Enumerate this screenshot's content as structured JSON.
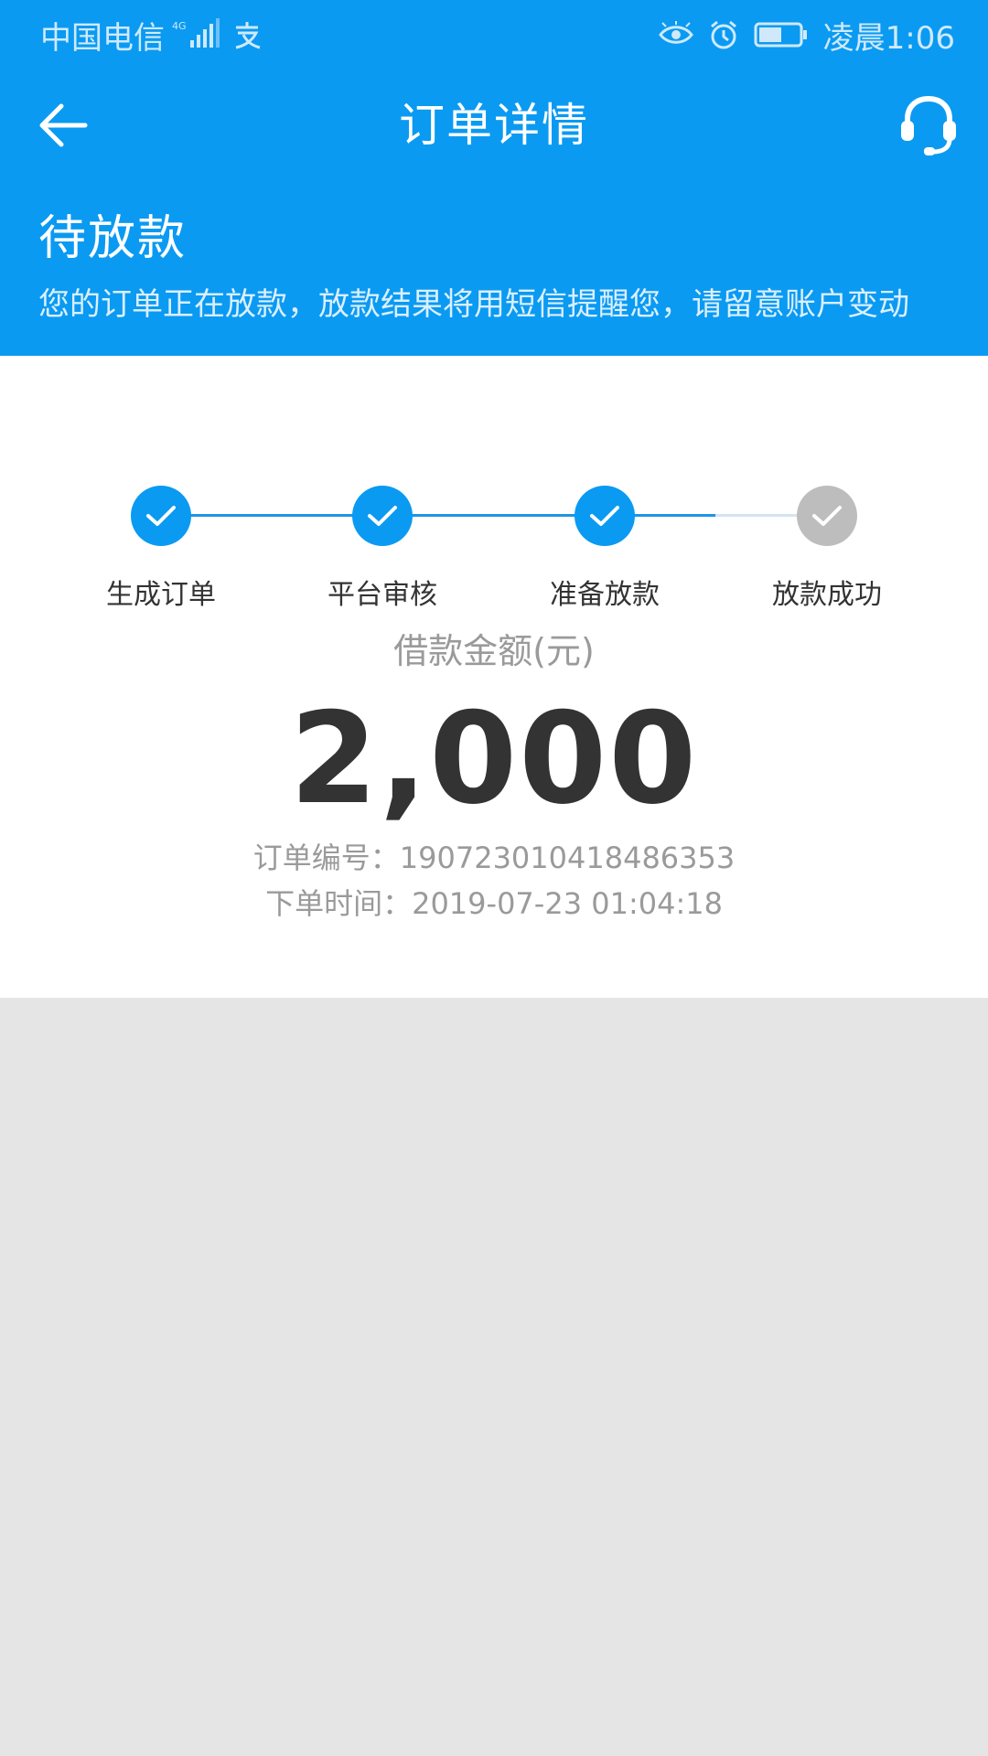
{
  "statusbar": {
    "carrier": "中国电信",
    "network": "4G",
    "time": "凌晨1:06"
  },
  "navbar": {
    "title": "订单详情"
  },
  "status": {
    "title": "待放款",
    "description": "您的订单正在放款，放款结果将用短信提醒您，请留意账户变动"
  },
  "steps": [
    {
      "label": "生成订单",
      "done": true
    },
    {
      "label": "平台审核",
      "done": true
    },
    {
      "label": "准备放款",
      "done": true
    },
    {
      "label": "放款成功",
      "done": false
    }
  ],
  "loan": {
    "amount_label": "借款金额(元)",
    "amount": "2,000",
    "order_no_label": "订单编号：",
    "order_no": "190723010418486353",
    "order_time_label": "下单时间：",
    "order_time": "2019-07-23 01:04:18"
  },
  "colors": {
    "primary": "#0a9af2",
    "pending": "#bdbdbd",
    "background": "#e5e5e5"
  }
}
